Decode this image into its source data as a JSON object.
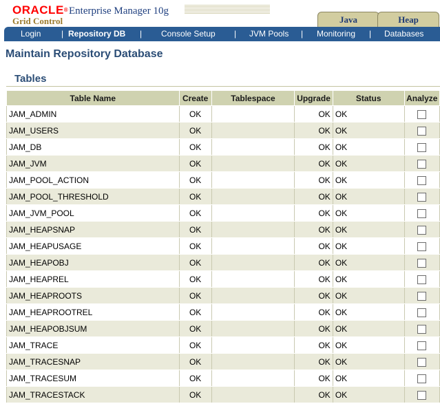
{
  "header": {
    "brand": "ORACLE",
    "reg_mark": "®",
    "product": "Enterprise Manager 10g",
    "subproduct": "Grid Control",
    "tabs": [
      {
        "label": "Java"
      },
      {
        "label": "Heap"
      }
    ]
  },
  "nav": {
    "items": [
      {
        "label": "Login"
      },
      {
        "label": "Repository DB"
      },
      {
        "label": "Console Setup"
      },
      {
        "label": "JVM Pools"
      },
      {
        "label": "Monitoring"
      },
      {
        "label": "Databases"
      }
    ],
    "separator": "|",
    "current": "Repository DB"
  },
  "page": {
    "title": "Maintain Repository Database",
    "section": "Tables"
  },
  "table": {
    "columns": [
      "Table Name",
      "Create",
      "Tablespace",
      "Upgrade",
      "Status",
      "Analyze"
    ],
    "rows": [
      {
        "name": "JAM_ADMIN",
        "create": "OK",
        "tablespace": "",
        "upgrade": "OK",
        "status": "OK"
      },
      {
        "name": "JAM_USERS",
        "create": "OK",
        "tablespace": "",
        "upgrade": "OK",
        "status": "OK"
      },
      {
        "name": "JAM_DB",
        "create": "OK",
        "tablespace": "",
        "upgrade": "OK",
        "status": "OK"
      },
      {
        "name": "JAM_JVM",
        "create": "OK",
        "tablespace": "",
        "upgrade": "OK",
        "status": "OK"
      },
      {
        "name": "JAM_POOL_ACTION",
        "create": "OK",
        "tablespace": "",
        "upgrade": "OK",
        "status": "OK"
      },
      {
        "name": "JAM_POOL_THRESHOLD",
        "create": "OK",
        "tablespace": "",
        "upgrade": "OK",
        "status": "OK"
      },
      {
        "name": "JAM_JVM_POOL",
        "create": "OK",
        "tablespace": "",
        "upgrade": "OK",
        "status": "OK"
      },
      {
        "name": "JAM_HEAPSNAP",
        "create": "OK",
        "tablespace": "",
        "upgrade": "OK",
        "status": "OK"
      },
      {
        "name": "JAM_HEAPUSAGE",
        "create": "OK",
        "tablespace": "",
        "upgrade": "OK",
        "status": "OK"
      },
      {
        "name": "JAM_HEAPOBJ",
        "create": "OK",
        "tablespace": "",
        "upgrade": "OK",
        "status": "OK"
      },
      {
        "name": "JAM_HEAPREL",
        "create": "OK",
        "tablespace": "",
        "upgrade": "OK",
        "status": "OK"
      },
      {
        "name": "JAM_HEAPROOTS",
        "create": "OK",
        "tablespace": "",
        "upgrade": "OK",
        "status": "OK"
      },
      {
        "name": "JAM_HEAPROOTREL",
        "create": "OK",
        "tablespace": "",
        "upgrade": "OK",
        "status": "OK"
      },
      {
        "name": "JAM_HEAPOBJSUM",
        "create": "OK",
        "tablespace": "",
        "upgrade": "OK",
        "status": "OK"
      },
      {
        "name": "JAM_TRACE",
        "create": "OK",
        "tablespace": "",
        "upgrade": "OK",
        "status": "OK"
      },
      {
        "name": "JAM_TRACESNAP",
        "create": "OK",
        "tablespace": "",
        "upgrade": "OK",
        "status": "OK"
      },
      {
        "name": "JAM_TRACESUM",
        "create": "OK",
        "tablespace": "",
        "upgrade": "OK",
        "status": "OK"
      },
      {
        "name": "JAM_TRACESTACK",
        "create": "OK",
        "tablespace": "",
        "upgrade": "OK",
        "status": "OK"
      }
    ]
  },
  "colors": {
    "brand_red": "#ff0000",
    "nav_blue": "#2a5c94",
    "title_blue": "#2b4d76",
    "tab_tan": "#d2cda0",
    "header_cell": "#cfd2b0",
    "row_alt": "#eaeada"
  }
}
